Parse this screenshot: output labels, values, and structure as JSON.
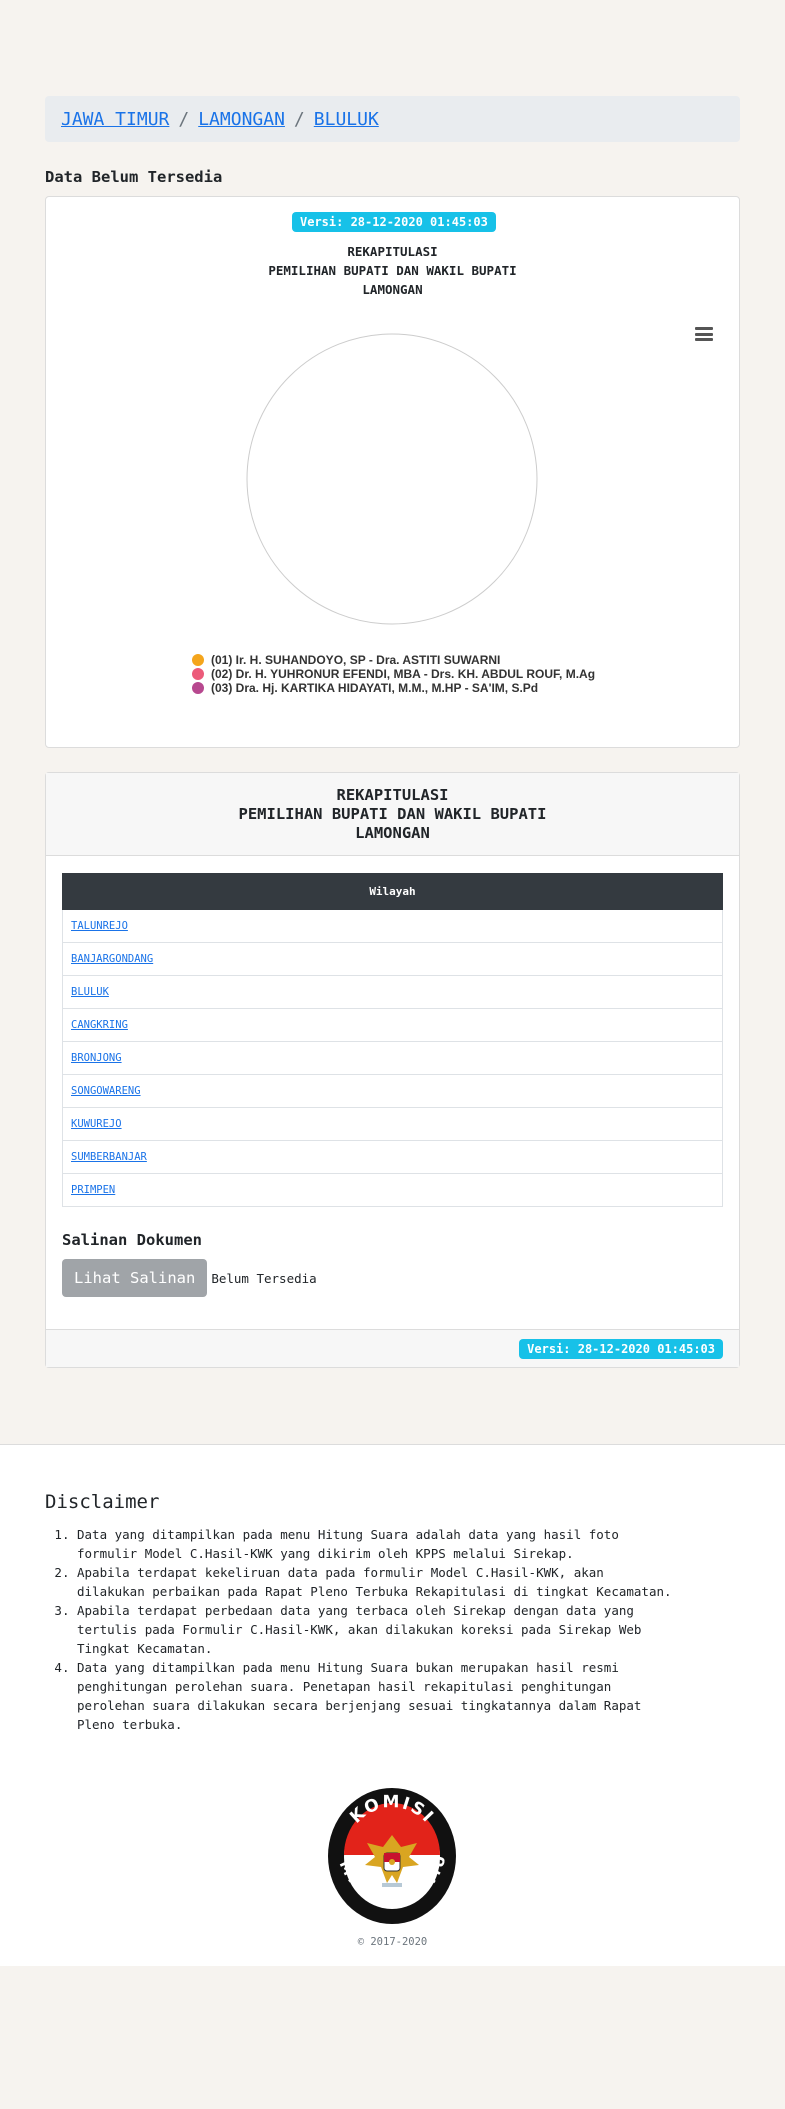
{
  "breadcrumb": {
    "province": "JAWA TIMUR",
    "regency": "LAMONGAN",
    "district": "BLULUK",
    "separator": "/"
  },
  "status_text": "Data Belum Tersedia",
  "chart": {
    "version_badge": "Versi: 28-12-2020 01:45:03",
    "title_line1": "REKAPITULASI",
    "title_line2": "PEMILIHAN BUPATI DAN WAKIL BUPATI",
    "title_line3": "LAMONGAN",
    "menu_icon": "hamburger-menu-icon"
  },
  "chart_data": {
    "type": "pie",
    "title": "REKAPITULASI PEMILIHAN BUPATI DAN WAKIL BUPATI LAMONGAN",
    "categories": [
      "(01) Ir. H. SUHANDOYO, SP - Dra. ASTITI SUWARNI",
      "(02) Dr. H. YUHRONUR EFENDI, MBA - Drs. KH. ABDUL ROUF, M.Ag",
      "(03) Dra. Hj. KARTIKA HIDAYATI, M.M., M.HP - SA'IM, S.Pd"
    ],
    "values": [
      0,
      0,
      0
    ],
    "colors": [
      "#f4a51c",
      "#ec5b7a",
      "#b7488f"
    ],
    "legend_position": "bottom"
  },
  "table": {
    "title_line1": "REKAPITULASI",
    "title_line2": "PEMILIHAN BUPATI DAN WAKIL BUPATI",
    "title_line3": "LAMONGAN",
    "header": "Wilayah",
    "rows": [
      "TALUNREJO",
      "BANJARGONDANG",
      "BLULUK",
      "CANGKRING",
      "BRONJONG",
      "SONGOWARENG",
      "KUWUREJO",
      "SUMBERBANJAR",
      "PRIMPEN"
    ],
    "salinan_title": "Salinan Dokumen",
    "salinan_button": "Lihat Salinan",
    "salinan_status": "Belum Tersedia",
    "version_badge": "Versi: 28-12-2020 01:45:03"
  },
  "footer": {
    "disclaimer_title": "Disclaimer",
    "items": [
      "Data yang ditampilkan pada menu Hitung Suara adalah data yang hasil foto formulir Model C.Hasil-KWK yang dikirim oleh KPPS melalui Sirekap.",
      "Apabila terdapat kekeliruan data pada formulir Model C.Hasil-KWK, akan dilakukan perbaikan pada Rapat Pleno Terbuka Rekapitulasi di tingkat Kecamatan.",
      "Apabila terdapat perbedaan data yang terbaca oleh Sirekap dengan data yang tertulis pada Formulir C.Hasil-KWK, akan dilakukan koreksi pada Sirekap Web Tingkat Kecamatan.",
      "Data yang ditampilkan pada menu Hitung Suara bukan merupakan hasil resmi penghitungan perolehan suara. Penetapan hasil rekapitulasi penghitungan perolehan suara dilakukan secara berjenjang sesuai tingkatannya dalam Rapat Pleno terbuka."
    ],
    "logo_top_text": "KOMISI",
    "logo_bottom_text": "PEMILIHAN UMUM",
    "copyright": "© 2017-2020"
  }
}
